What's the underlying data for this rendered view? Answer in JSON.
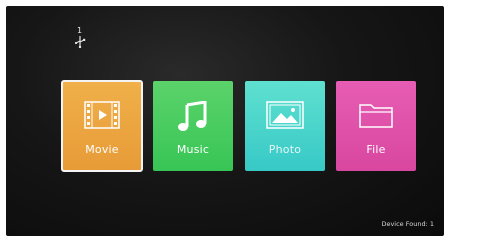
{
  "status": {
    "usb_count": "1",
    "device_found": "Device Found: 1"
  },
  "menu": {
    "items": [
      {
        "id": "movie",
        "label": "Movie",
        "icon": "film-icon",
        "color": "#e79b37"
      },
      {
        "id": "music",
        "label": "Music",
        "icon": "music-note-icon",
        "color": "#38c556"
      },
      {
        "id": "photo",
        "label": "Photo",
        "icon": "image-icon",
        "color": "#37c9c6"
      },
      {
        "id": "file",
        "label": "File",
        "icon": "folder-icon",
        "color": "#d9479f"
      }
    ],
    "selected": "Movie"
  },
  "colors": {
    "background": "#161616",
    "text": "#ffffff",
    "selection_outline": "#f4f4f4"
  }
}
